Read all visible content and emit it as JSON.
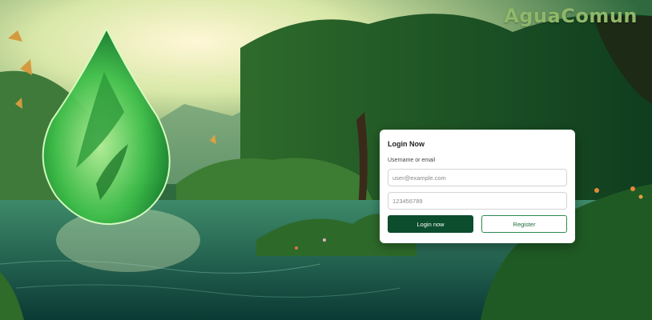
{
  "brand": {
    "name": "AguaComun"
  },
  "login": {
    "title": "Login Now",
    "username_label": "Username or email",
    "username_placeholder": "user@example.com",
    "password_placeholder": "123456789",
    "login_button": "Login now",
    "register_button": "Register"
  },
  "colors": {
    "brand_text": "#8fb86a",
    "primary_button": "#0b4d2c",
    "secondary_border": "#2f8a52"
  }
}
